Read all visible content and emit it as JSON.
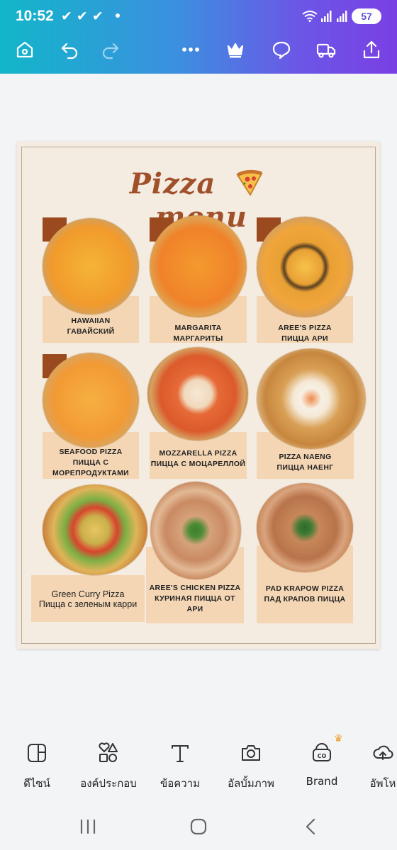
{
  "status_bar": {
    "time": "10:52",
    "checks": "✔✔✔",
    "battery": "57"
  },
  "toolbar": {
    "icons": [
      "home-icon",
      "undo-icon",
      "redo-icon",
      "more-icon",
      "crown-icon",
      "comment-icon",
      "delivery-icon",
      "share-icon"
    ]
  },
  "design": {
    "title_left": "Pizza",
    "title_right": "menu",
    "items": [
      {
        "line1": "HAWAIIAN",
        "line2": "ГАВАЙСКИЙ",
        "line3": ""
      },
      {
        "line1": "MARGARITA",
        "line2": "МАРГАРИТЫ",
        "line3": ""
      },
      {
        "line1": "AREE'S PIZZA",
        "line2": "ПИЦЦА АРИ",
        "line3": ""
      },
      {
        "line1": "SEAFOOD PIZZA",
        "line2": "ПИЦЦА С",
        "line3": "МОРЕПРОДУКТАМИ"
      },
      {
        "line1": "MOZZARELLA PIZZA",
        "line2": "ПИЦЦА С МОЦАРЕЛЛОЙ",
        "line3": ""
      },
      {
        "line1": "PIZZA NAENG",
        "line2": "ПИЦЦА НАЕНГ",
        "line3": ""
      },
      {
        "line1": "Green Curry Pizza",
        "line2": "Пицца с зеленым карри",
        "line3": ""
      },
      {
        "line1": "AREE'S CHICKEN PIZZA",
        "line2": "КУРИНАЯ ПИЦЦА ОТ АРИ",
        "line3": ""
      },
      {
        "line1": "PAD KRAPOW PIZZA",
        "line2": "ПАД КРАПОВ ПИЦЦА",
        "line3": ""
      }
    ]
  },
  "bottom_tools": [
    {
      "label": "ดีไซน์",
      "icon": "design-icon"
    },
    {
      "label": "องค์ประกอบ",
      "icon": "elements-icon"
    },
    {
      "label": "ข้อความ",
      "icon": "text-icon"
    },
    {
      "label": "อัลบั้มภาพ",
      "icon": "camera-icon"
    },
    {
      "label": "Brand",
      "icon": "brand-icon"
    },
    {
      "label": "อัพโห",
      "icon": "upload-icon"
    }
  ],
  "colors": {
    "title": "#a0512a",
    "card": "#f4d6b5",
    "page": "#f4ebe1",
    "accent": "#9b4a1f"
  }
}
